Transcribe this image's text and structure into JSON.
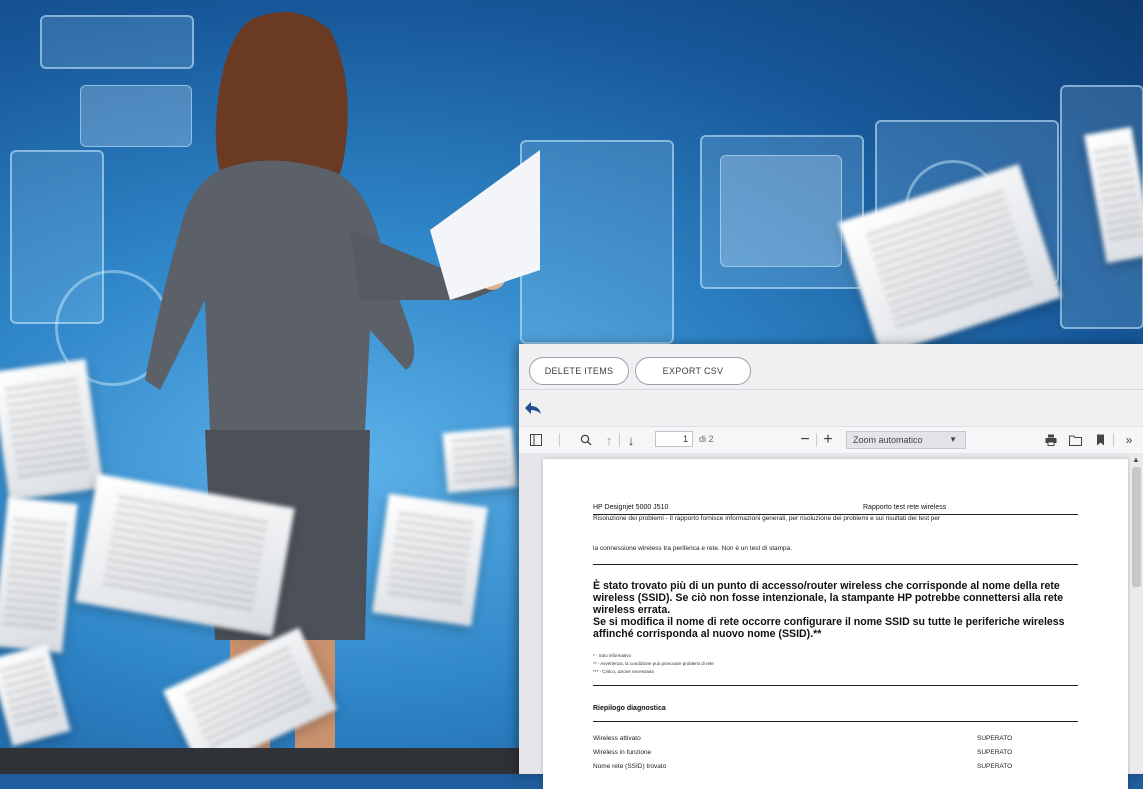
{
  "actions": {
    "delete_label": "DELETE ITEMS",
    "export_label": "EXPORT CSV"
  },
  "toolbar": {
    "page_current": "1",
    "page_total": "di 2",
    "zoom_value": "Zoom automatico"
  },
  "icons": {
    "back": "back-arrow-icon",
    "sidebar": "sidebar-toggle-icon",
    "search": "search-icon",
    "prev": "arrow-up-icon",
    "next": "arrow-down-icon",
    "zoom_out": "minus-icon",
    "zoom_in": "plus-icon",
    "print": "print-icon",
    "open": "folder-icon",
    "bookmark": "bookmark-icon",
    "more": "double-chevron-right-icon"
  },
  "document": {
    "header_left": "HP Designjet 5000 J510",
    "header_right": "Rapporto test rete wireless",
    "intro_line1": "Risoluzione dei problemi - Il rapporto fornisce informazioni generali, per risoluzione dei problemi e sui risultati dei test per",
    "intro_line2": "la connessione wireless tra periferica e rete. Non è un test di stampa.",
    "message": "È stato trovato più di un punto di accesso/router wireless che corrisponde al nome della rete wireless (SSID). Se ciò non fosse intenzionale, la stampante HP potrebbe connettersi alla rete wireless errata.\nSe si modifica il nome di rete occorre configurare il nome SSID su tutte le periferiche wireless affinché corrisponda al nuovo nome (SSID).**",
    "legend1": "* - Solo informativo",
    "legend2": "** - Avvertenza, la condizione può provocare problemi di rete",
    "legend3": "*** - Critico, azione necessaria",
    "section_title": "Riepilogo diagnostica",
    "rows": [
      {
        "label": "Wireless attivato",
        "result": "SUPERATO"
      },
      {
        "label": "Wireless in funzione",
        "result": "SUPERATO"
      },
      {
        "label": "Nome rete (SSID) trovato",
        "result": "SUPERATO"
      }
    ]
  },
  "colors": {
    "accent": "#1f4e8a",
    "panel_bg": "#f0f0f3",
    "bottom_bar": "#2f3338"
  }
}
